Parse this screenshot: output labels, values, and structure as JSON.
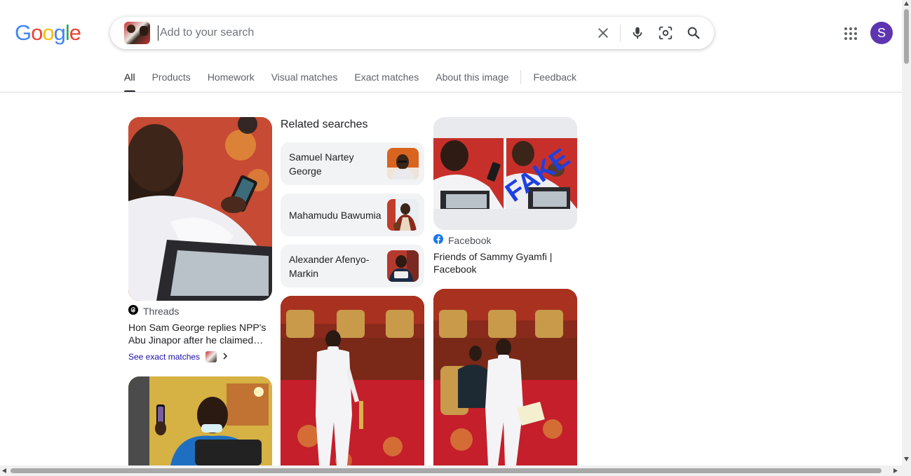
{
  "logo": {
    "letters": [
      "G",
      "o",
      "o",
      "g",
      "l",
      "e"
    ]
  },
  "search": {
    "placeholder": "Add to your search"
  },
  "icons": {
    "clear": "close-icon",
    "voice": "microphone-icon",
    "lens": "camera-lens-icon",
    "search": "search-icon",
    "apps": "apps-grid-icon"
  },
  "avatar": {
    "initial": "S",
    "color": "#5e35b1"
  },
  "tabs": [
    {
      "label": "All",
      "active": true
    },
    {
      "label": "Products"
    },
    {
      "label": "Homework"
    },
    {
      "label": "Visual matches"
    },
    {
      "label": "Exact matches"
    },
    {
      "label": "About this image"
    },
    {
      "label": "Feedback"
    }
  ],
  "results": {
    "threads_card": {
      "source": "Threads",
      "title": "Hon Sam George replies NPP's Abu Jinapor after he claimed…",
      "see_exact": "See exact matches"
    },
    "facebook_card": {
      "source": "Facebook",
      "title": "Friends of Sammy Gyamfi | Facebook",
      "overlay_text": "FAKE"
    }
  },
  "related": {
    "heading": "Related searches",
    "items": [
      {
        "label": "Samuel Nartey George"
      },
      {
        "label": "Mahamudu Bawumia"
      },
      {
        "label": "Alexander Afenyo-Markin"
      }
    ]
  },
  "colors": {
    "accent": "#1a0dab",
    "text": "#202124",
    "muted": "#5f6368"
  }
}
